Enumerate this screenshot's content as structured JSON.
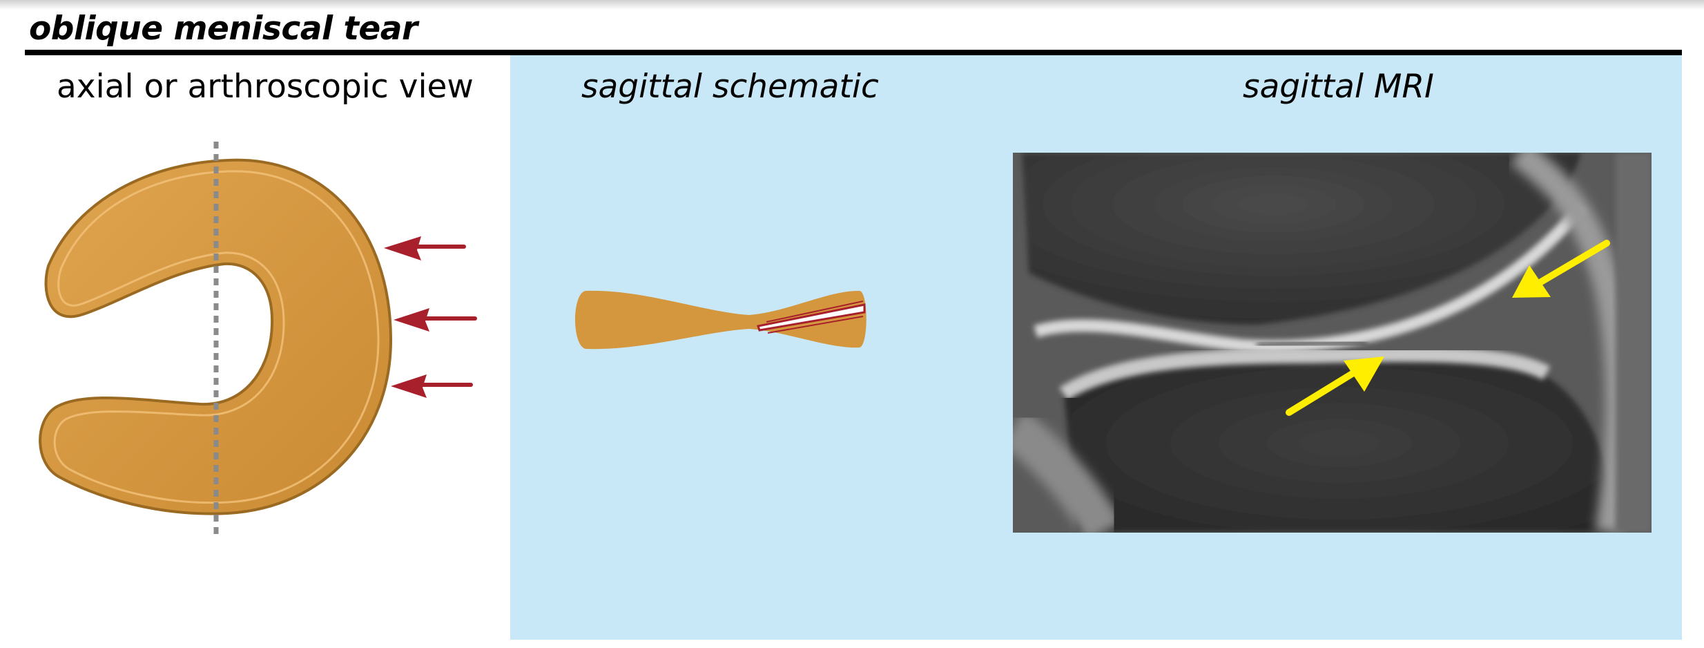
{
  "title": "oblique meniscal tear",
  "panels": {
    "axial": {
      "heading": "axial or arthroscopic view"
    },
    "sagittal_schematic": {
      "heading": "sagittal schematic"
    },
    "sagittal_mri": {
      "heading": "sagittal MRI"
    }
  },
  "colors": {
    "meniscus": "#d4973e",
    "meniscus_edge": "#9a6a22",
    "tear_red": "#a8202c",
    "arrow_red": "#a8202c",
    "arrow_yellow": "#ffee00",
    "panel_blue": "#c8e8f8",
    "section_line": "#8a8a8a"
  },
  "annotations": {
    "axial_red_arrows": 3,
    "mri_yellow_arrows": 2
  }
}
